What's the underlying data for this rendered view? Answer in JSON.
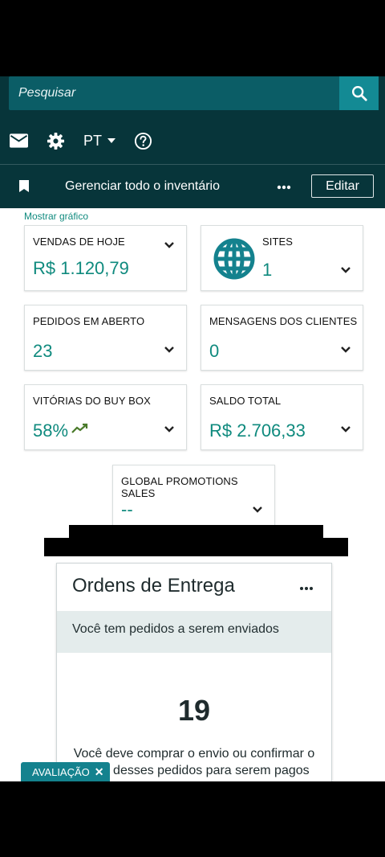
{
  "search": {
    "placeholder": "Pesquisar"
  },
  "toolbar": {
    "language": "PT"
  },
  "subbar": {
    "label": "Gerenciar todo o inventário",
    "edit_label": "Editar"
  },
  "show_chart": "Mostrar gráfico",
  "cards": [
    {
      "title": "VENDAS DE HOJE",
      "value": "R$ 1.120,79"
    },
    {
      "title": "SITES",
      "value": "1",
      "icon": "globe-icon"
    },
    {
      "title": "PEDIDOS EM ABERTO",
      "value": "23"
    },
    {
      "title": "MENSAGENS DOS CLIENTES",
      "value": "0"
    },
    {
      "title": "VITÓRIAS DO BUY BOX",
      "value": "58%",
      "icon": "trending-up-icon"
    },
    {
      "title": "SALDO TOTAL",
      "value": "R$ 2.706,33"
    },
    {
      "title": "GLOBAL PROMOTIONS SALES",
      "value": "--"
    }
  ],
  "orders": {
    "title": "Ordens de Entrega",
    "notice": "Você tem pedidos a serem enviados",
    "count": "19",
    "description": "Você deve comprar o envio ou confirmar o envio desses pedidos para serem pagos"
  },
  "feedback": {
    "label": "AVALIAÇÃO",
    "close": "✕"
  },
  "colors": {
    "header": "#07353a",
    "search_bg": "#0b5d66",
    "accent": "#138a94",
    "value_green": "#0f8a7e"
  }
}
